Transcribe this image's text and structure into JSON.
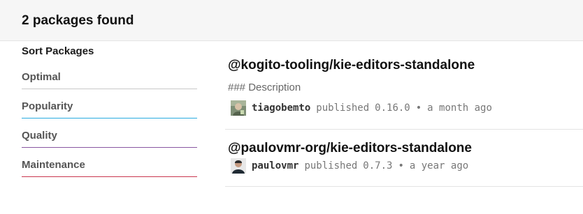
{
  "header": {
    "title": "2 packages found"
  },
  "sidebar": {
    "heading": "Sort Packages",
    "options": [
      {
        "label": "Optimal",
        "color": "#c8c8c8"
      },
      {
        "label": "Popularity",
        "color": "#29abe0"
      },
      {
        "label": "Quality",
        "color": "#8956a1"
      },
      {
        "label": "Maintenance",
        "color": "#c9364f"
      }
    ]
  },
  "packages": [
    {
      "name": "@kogito-tooling/kie-editors-standalone",
      "description": "### Description",
      "publisher": "tiagobemto",
      "published_label": "published",
      "version": "0.16.0",
      "separator": "•",
      "time": "a month ago",
      "avatar_icon": "user-avatar-icon"
    },
    {
      "name": "@paulovmr-org/kie-editors-standalone",
      "publisher": "paulovmr",
      "published_label": "published",
      "version": "0.7.3",
      "separator": "•",
      "time": "a year ago",
      "avatar_icon": "user-avatar-icon"
    }
  ]
}
